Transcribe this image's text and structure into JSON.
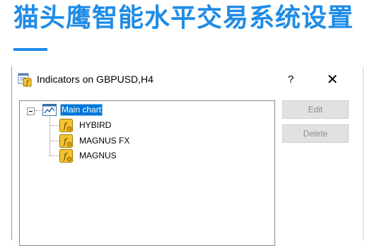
{
  "banner": {
    "title": "猫头鹰智能水平交易系统设置",
    "accent_color": "#1f8ce6"
  },
  "dialog": {
    "title": "Indicators on GBPUSD,H4",
    "title_icon": "indicators-list-icon",
    "help_label": "?",
    "close_label": "✕"
  },
  "tree": {
    "root": {
      "label": "Main chart",
      "icon": "chart-window-icon",
      "selected": true,
      "expanded": true
    },
    "items": [
      {
        "label": "HYBIRD",
        "icon": "custom-indicator-icon"
      },
      {
        "label": "MAGNUS FX",
        "icon": "custom-indicator-icon"
      },
      {
        "label": "MAGNUS",
        "icon": "custom-indicator-icon"
      }
    ]
  },
  "buttons": {
    "edit_label": "Edit",
    "delete_label": "Delete",
    "enabled": false
  }
}
